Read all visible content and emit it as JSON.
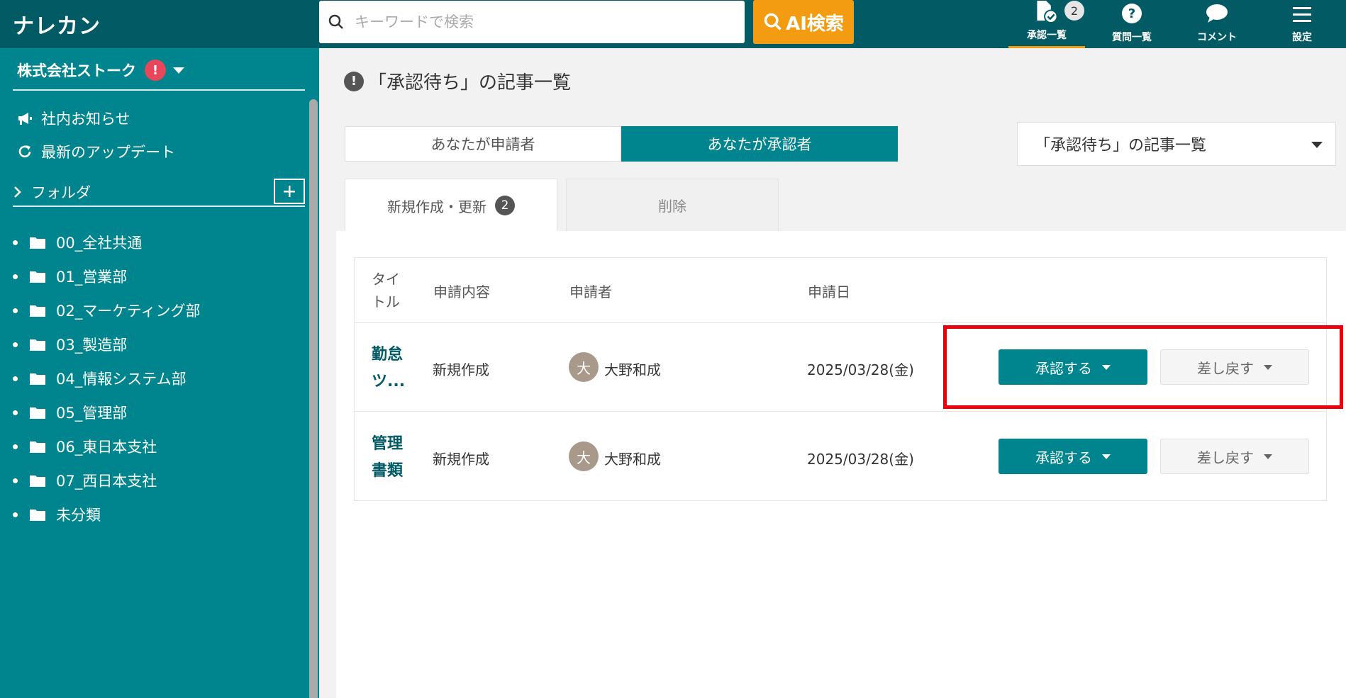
{
  "app": {
    "logo": "ナレカン",
    "search_placeholder": "キーワードで検索",
    "ai_search_label": "AI検索"
  },
  "nav": {
    "approvals": {
      "label": "承認一覧",
      "badge": "2"
    },
    "questions": {
      "label": "質問一覧"
    },
    "comments": {
      "label": "コメント"
    },
    "settings": {
      "label": "設定"
    }
  },
  "sidebar": {
    "company": "株式会社ストーク",
    "alert": "!",
    "links": [
      {
        "label": "社内お知らせ",
        "icon": "megaphone-icon"
      },
      {
        "label": "最新のアップデート",
        "icon": "refresh-icon"
      }
    ],
    "folder_header": "フォルダ",
    "folders": [
      "00_全社共通",
      "01_営業部",
      "02_マーケティング部",
      "03_製造部",
      "04_情報システム部",
      "05_管理部",
      "06_東日本支社",
      "07_西日本支社",
      "未分類"
    ]
  },
  "main": {
    "page_title": "「承認待ち」の記事一覧",
    "role_tabs": [
      "あなたが申請者",
      "あなたが承認者"
    ],
    "active_role": 1,
    "list_select": "「承認待ち」の記事一覧",
    "tabs": [
      {
        "label": "新規作成・更新",
        "count": "2"
      },
      {
        "label": "削除"
      }
    ],
    "table": {
      "headers": {
        "title_1": "タイ",
        "title_2": "トル",
        "content": "申請内容",
        "applicant": "申請者",
        "date": "申請日"
      },
      "rows": [
        {
          "title_1": "勤怠",
          "title_2": "ツ...",
          "content": "新規作成",
          "avatar": "大",
          "applicant": "大野和成",
          "date": "2025/03/28(金)",
          "approve": "承認する",
          "reject": "差し戻す"
        },
        {
          "title_1": "管理",
          "title_2": "書類",
          "content": "新規作成",
          "avatar": "大",
          "applicant": "大野和成",
          "date": "2025/03/28(金)",
          "approve": "承認する",
          "reject": "差し戻す"
        }
      ]
    }
  },
  "colors": {
    "topbar": "#015a64",
    "sidebar": "#00848e",
    "accent_orange": "#f39c12",
    "highlight_red": "#e8000d"
  }
}
